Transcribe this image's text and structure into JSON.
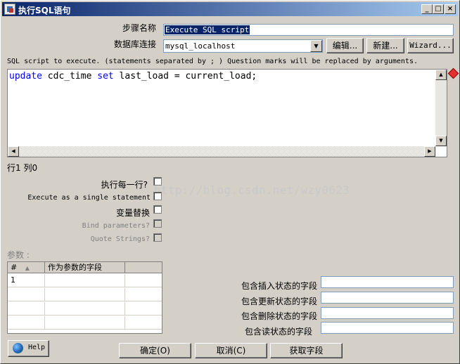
{
  "window": {
    "title": "执行SQL语句",
    "min": "_",
    "max": "□",
    "close": "×"
  },
  "step_name": {
    "label": "步骤名称",
    "value": "Execute SQL script"
  },
  "connection": {
    "label": "数据库连接",
    "value": "mysql_localhost",
    "edit": "编辑...",
    "new": "新建...",
    "wizard": "Wizard..."
  },
  "sql": {
    "hint": "SQL script to execute. (statements separated by ; ) Question marks will be replaced by arguments.",
    "tokens": [
      {
        "text": "update",
        "kw": true
      },
      {
        "text": " cdc_time ",
        "kw": false
      },
      {
        "text": "set",
        "kw": true
      },
      {
        "text": " last_load = current_load;",
        "kw": false
      }
    ],
    "position": "行1 列0"
  },
  "options": {
    "execute_each_row": "执行每一行?",
    "single_statement": "Execute as a single statement",
    "variable_substitution": "变量替换",
    "bind_parameters": "Bind parameters?",
    "quote_strings": "Quote Strings?"
  },
  "params": {
    "label": "参数 :",
    "columns": [
      "#",
      "作为参数的字段"
    ],
    "rows": [
      [
        "1",
        ""
      ]
    ]
  },
  "status_fields": {
    "insert": "包含插入状态的字段",
    "update": "包含更新状态的字段",
    "delete": "包含删除状态的字段",
    "read": "包含读状态的字段"
  },
  "buttons": {
    "help": "Help",
    "ok": "确定(O)",
    "cancel": "取消(C)",
    "get_fields": "获取字段"
  },
  "watermark": "http://blog.csdn.net/wzy0623"
}
